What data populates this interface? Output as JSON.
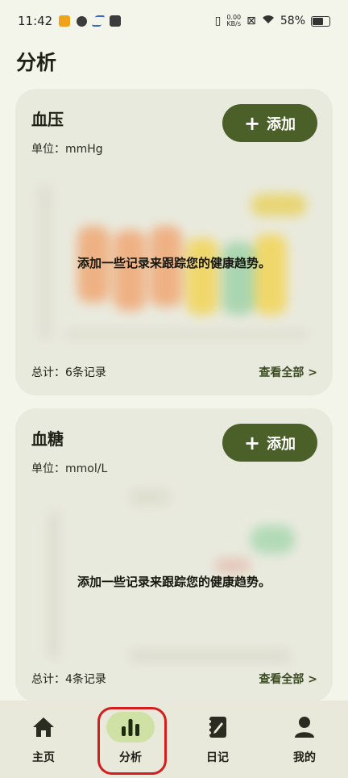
{
  "status": {
    "time": "11:42",
    "net_speed_value": "0.00",
    "net_speed_unit": "KB/s",
    "battery": "58%",
    "battery_level": 0.58
  },
  "page": {
    "title": "分析"
  },
  "cards": [
    {
      "title": "血压",
      "unit": "单位：mmHg",
      "add_label": "添加",
      "empty_message": "添加一些记录来跟踪您的健康趋势。",
      "total": "总计：6条记录",
      "view_all": "查看全部 >"
    },
    {
      "title": "血糖",
      "unit": "单位：mmol/L",
      "add_label": "添加",
      "empty_message": "添加一些记录来跟踪您的健康趋势。",
      "total": "总计：4条记录",
      "view_all": "查看全部 >"
    }
  ],
  "nav": {
    "items": [
      {
        "label": "主页",
        "icon": "home-icon"
      },
      {
        "label": "分析",
        "icon": "bar-chart-icon",
        "active": true
      },
      {
        "label": "日记",
        "icon": "diary-icon"
      },
      {
        "label": "我的",
        "icon": "person-icon"
      }
    ]
  },
  "colors": {
    "accent": "#4b6028",
    "active_tab_bg": "#cfe1a5",
    "card_bg": "#e9eade",
    "page_bg": "#f4f5ea",
    "highlight": "#d21e1e"
  }
}
